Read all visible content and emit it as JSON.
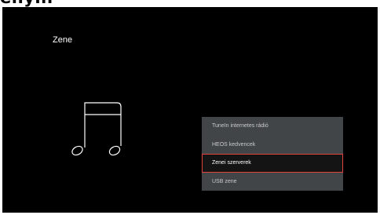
{
  "page_fragment": "enyin",
  "screen": {
    "title": "Zene",
    "icon": "music-note-icon",
    "menu": {
      "items": [
        {
          "label": "TuneIn internetes rádió"
        },
        {
          "label": "HEOS kedvencek"
        },
        {
          "label": "Zenei szerverek"
        },
        {
          "label": "USB zene"
        }
      ],
      "selected_index": 2,
      "selection_color": "#e0433a"
    }
  }
}
